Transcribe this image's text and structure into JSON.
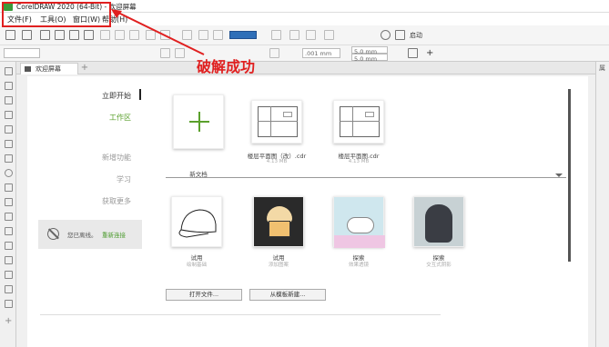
{
  "window": {
    "title": "CorelDRAW 2020 (64-Bit) - 欢迎屏幕"
  },
  "menubar": {
    "items": [
      "文件(F)",
      "工具(O)",
      "窗口(W)",
      "帮助(H)"
    ]
  },
  "annotation": {
    "text": "破解成功",
    "color": "#e02020"
  },
  "toolbar": {
    "zoom_field": "",
    "launch_label": "启动",
    "x_field": ".001 mm",
    "w_field": "5.0 mm",
    "h_field": "5.0 mm"
  },
  "tabs": {
    "active_tab": "欢迎屏幕",
    "add_symbol": "+"
  },
  "right_dock": {
    "label": "属"
  },
  "nav": {
    "get_started": "立即开始",
    "workspace": "工作区",
    "whats_new": "新增功能",
    "learn": "学习",
    "get_more": "获取更多"
  },
  "offline": {
    "message": "您已离线。",
    "reconnect": "重新连接"
  },
  "recent_files": [
    {
      "label": "新文档",
      "size": ""
    },
    {
      "label": "楼层平面图（改）.cdr",
      "size": "4.13 MB"
    },
    {
      "label": "楼层平面图.cdr",
      "size": "4.13 MB"
    }
  ],
  "templates": [
    {
      "label": "试用",
      "sub": "绘制基础"
    },
    {
      "label": "试用",
      "sub": "添加图案"
    },
    {
      "label": "探索",
      "sub": "效果透镜"
    },
    {
      "label": "探索",
      "sub": "交互式阴影"
    }
  ],
  "buttons": {
    "open_file": "打开文件...",
    "from_template": "从模板新建..."
  },
  "colors": {
    "accent": "#5aa02c",
    "toolbar_blue": "#2f6fb8"
  }
}
